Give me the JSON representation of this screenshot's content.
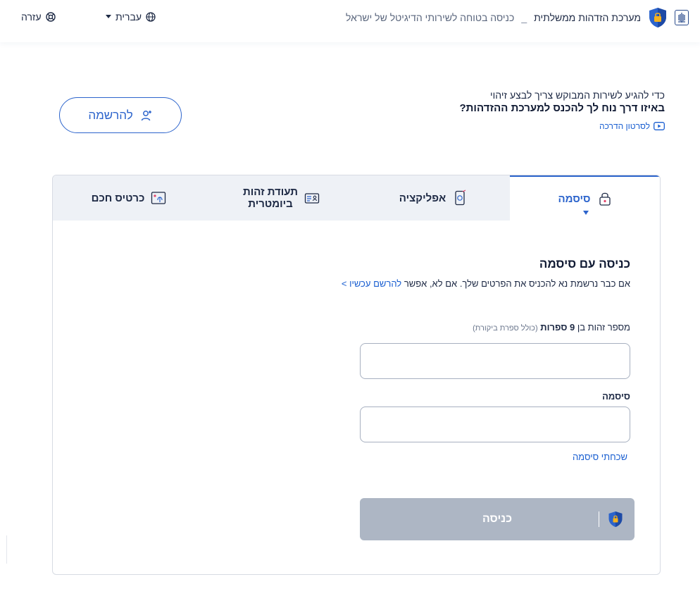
{
  "header": {
    "system_name": "מערכת הזדהות ממשלתית",
    "separator": "_",
    "tagline": "כניסה בטוחה לשירותי הדיגיטל של ישראל",
    "language": "עברית",
    "help": "עזרה",
    "icons": [
      "state-emblem-icon",
      "shield-lock-icon",
      "globe-icon",
      "chevron-down-icon",
      "help-lifebuoy-icon"
    ]
  },
  "intro": {
    "line1": "כדי להגיע לשירות המבוקש צריך לבצע זיהוי",
    "line2": "באיזו דרך נוח לך להכנס למערכת ההזדהות?",
    "video_link": "לסרטון הדרכה"
  },
  "register_button": "להרשמה",
  "tabs": [
    {
      "label": "סיסמה",
      "icon": "lock-icon",
      "active": true
    },
    {
      "label": "אפליקציה",
      "icon": "mobile-app-icon",
      "active": false
    },
    {
      "label_line1": "תעודת זהות",
      "label_line2": "ביומטרית",
      "icon": "id-card-icon",
      "active": false
    },
    {
      "label": "כרטיס חכם",
      "icon": "smart-card-icon",
      "active": false
    }
  ],
  "form": {
    "title": "כניסה עם סיסמה",
    "subtitle": "אם כבר נרשמת נא להכניס את הפרטים שלך. אם לא, אפשר",
    "subtitle_link": "להרשם עכשיו >",
    "id_label_prefix": "מספר זהות בן",
    "id_label_bold": "9 ספרות",
    "id_label_hint": "(כולל ספרת ביקורת)",
    "id_value": "",
    "password_label": "סיסמה",
    "password_value": "",
    "forgot": "שכחתי סיסמה",
    "submit": "כניסה"
  },
  "colors": {
    "accent": "#2c64cc",
    "link": "#1a5fd1",
    "tab_bg": "#eef1f6",
    "submit_disabled": "#adb6c4",
    "text_dark": "#101a33"
  }
}
